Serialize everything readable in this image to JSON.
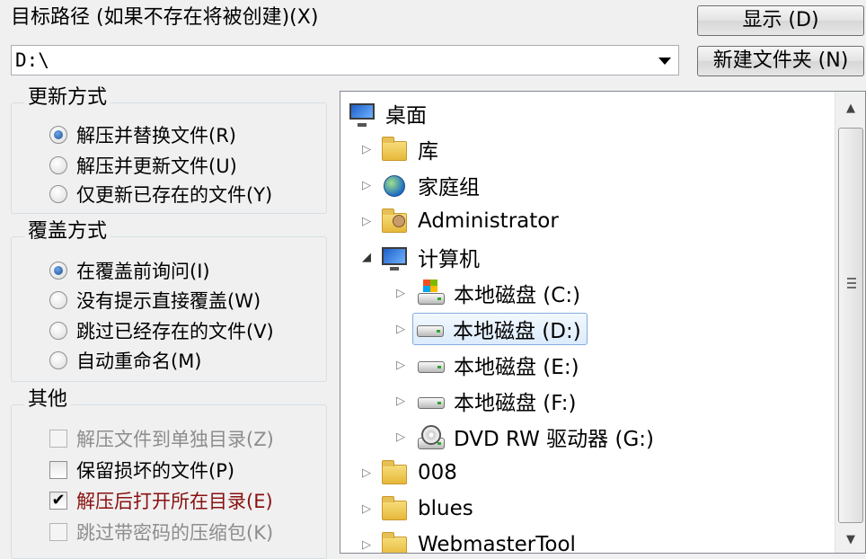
{
  "path_section": {
    "label": "目标路径 (如果不存在将被创建)(X)",
    "value": "D:\\"
  },
  "buttons": {
    "show": "显示 (D)",
    "new_folder": "新建文件夹 (N)"
  },
  "update_mode": {
    "title": "更新方式",
    "options": [
      {
        "label": "解压并替换文件(R)",
        "selected": true
      },
      {
        "label": "解压并更新文件(U)",
        "selected": false
      },
      {
        "label": "仅更新已存在的文件(Y)",
        "selected": false
      }
    ]
  },
  "overwrite_mode": {
    "title": "覆盖方式",
    "options": [
      {
        "label": "在覆盖前询问(I)",
        "selected": true
      },
      {
        "label": "没有提示直接覆盖(W)",
        "selected": false
      },
      {
        "label": "跳过已经存在的文件(V)",
        "selected": false
      },
      {
        "label": "自动重命名(M)",
        "selected": false
      }
    ]
  },
  "other": {
    "title": "其他",
    "options": [
      {
        "label": "解压文件到单独目录(Z)",
        "checked": false,
        "enabled": false
      },
      {
        "label": "保留损坏的文件(P)",
        "checked": false,
        "enabled": true
      },
      {
        "label": "解压后打开所在目录(E)",
        "checked": true,
        "enabled": true
      },
      {
        "label": "跳过带密码的压缩包(K)",
        "checked": false,
        "enabled": false
      }
    ]
  },
  "tree": {
    "items": [
      {
        "label": "桌面",
        "icon": "desktop-icon"
      },
      {
        "label": "库",
        "icon": "library-icon"
      },
      {
        "label": "家庭组",
        "icon": "homegroup-icon"
      },
      {
        "label": "Administrator",
        "icon": "user-folder-icon"
      },
      {
        "label": "计算机",
        "icon": "computer-icon"
      },
      {
        "label": "本地磁盘 (C:)",
        "icon": "system-drive-icon"
      },
      {
        "label": "本地磁盘 (D:)",
        "icon": "drive-icon",
        "selected": true
      },
      {
        "label": "本地磁盘 (E:)",
        "icon": "drive-icon"
      },
      {
        "label": "本地磁盘 (F:)",
        "icon": "drive-icon"
      },
      {
        "label": "DVD RW 驱动器 (G:)",
        "icon": "dvd-drive-icon"
      },
      {
        "label": "008",
        "icon": "folder-icon"
      },
      {
        "label": "blues",
        "icon": "folder-icon"
      },
      {
        "label": "WebmasterTool",
        "icon": "folder-icon"
      }
    ]
  }
}
